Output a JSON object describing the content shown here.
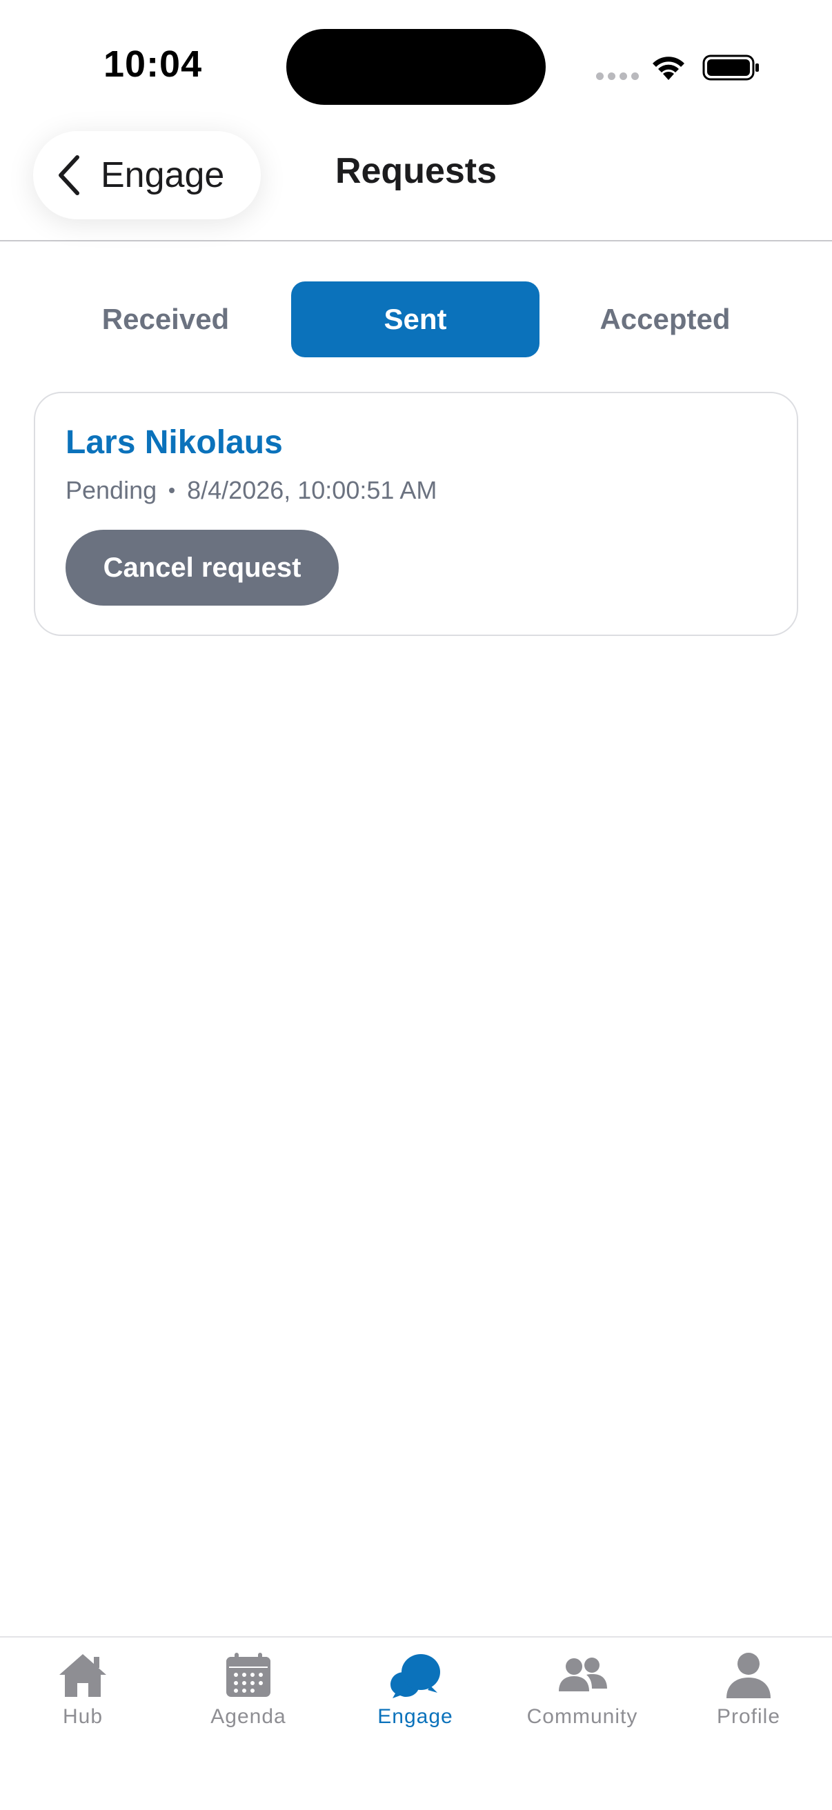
{
  "status_bar": {
    "time": "10:04"
  },
  "header": {
    "back_label": "Engage",
    "title": "Requests"
  },
  "tabs": [
    {
      "label": "Received",
      "active": false
    },
    {
      "label": "Sent",
      "active": true
    },
    {
      "label": "Accepted",
      "active": false
    }
  ],
  "requests": [
    {
      "name": "Lars Nikolaus",
      "status": "Pending",
      "timestamp": "8/4/2026, 10:00:51 AM",
      "action_label": "Cancel request"
    }
  ],
  "tab_bar": {
    "items": [
      {
        "label": "Hub",
        "icon": "home-icon",
        "active": false
      },
      {
        "label": "Agenda",
        "icon": "calendar-icon",
        "active": false
      },
      {
        "label": "Engage",
        "icon": "chat-bubbles-icon",
        "active": true
      },
      {
        "label": "Community",
        "icon": "people-icon",
        "active": false
      },
      {
        "label": "Profile",
        "icon": "person-icon",
        "active": false
      }
    ]
  },
  "colors": {
    "accent": "#0b72bb",
    "muted": "#6b7280",
    "inactive_tab_icon": "#8e8e93"
  }
}
